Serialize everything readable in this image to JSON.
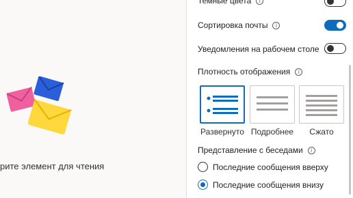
{
  "reading_pane": {
    "empty_text": "рите элемент для чтения",
    "illustration_icon": "envelopes-illustration"
  },
  "settings": {
    "dark_colors": {
      "label": "Темные цвета",
      "enabled": false
    },
    "sort_mail": {
      "label": "Сортировка почты",
      "enabled": true
    },
    "desktop_notifications": {
      "label": "Уведомления на рабочем столе",
      "enabled": false
    },
    "density": {
      "heading": "Плотность отображения",
      "options": [
        {
          "label": "Развернуто",
          "selected": true
        },
        {
          "label": "Подробнее",
          "selected": false
        },
        {
          "label": "Сжато",
          "selected": false
        }
      ]
    },
    "conversation_view": {
      "heading": "Представление с беседами",
      "options": [
        {
          "label": "Последние сообщения вверху",
          "selected": false
        },
        {
          "label": "Последние сообщения внизу",
          "selected": true
        }
      ]
    }
  },
  "colors": {
    "accent": "#0f6cbd"
  }
}
